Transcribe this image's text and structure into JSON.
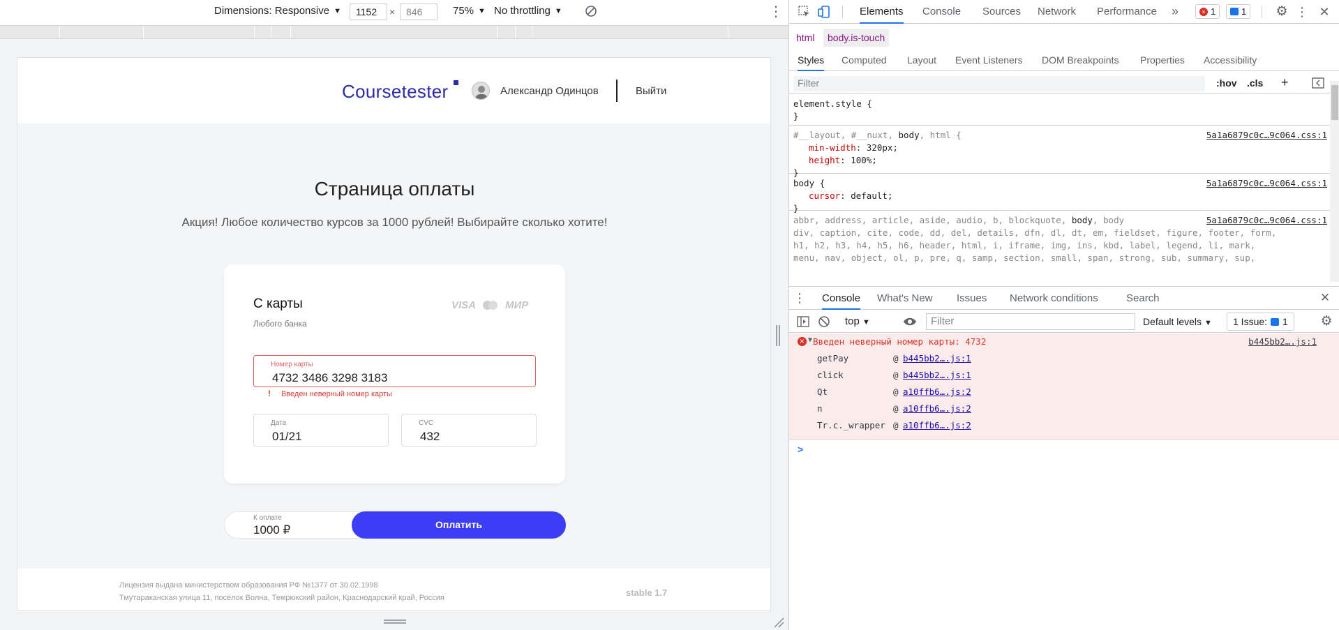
{
  "device_toolbar": {
    "dimensions_label": "Dimensions: Responsive",
    "width": "1152",
    "height": "846",
    "times": "×",
    "zoom": "75%",
    "throttling": "No throttling"
  },
  "page": {
    "logo": "Coursetester",
    "user_name": "Александр Одинцов",
    "logout": "Выйти",
    "title": "Страница оплаты",
    "promo": "Акция! Любое количество курсов за 1000 рублей! Выбирайте сколько хотите!",
    "card": {
      "title": "С карты",
      "subtitle": "Любого банка",
      "brands": [
        "VISA",
        "МИР"
      ],
      "card_number_label": "Номер карты",
      "card_number_value": "4732 3486 3298 3183",
      "error_mark": "!",
      "error_message": "Введен неверный номер карты",
      "date_label": "Дата",
      "date_value": "01/21",
      "cvc_label": "CVC",
      "cvc_value": "432"
    },
    "pay": {
      "label": "К оплате",
      "amount": "1000 ₽",
      "button": "Оплатить"
    },
    "footer": {
      "license": "Лицензия выдана министерством образования РФ №1377 от 30.02.1998",
      "address": "Тмутараканская улица 11, посёлок Волна, Темрюкский район, Краснодарский край, Россия",
      "version": "stable 1.7"
    }
  },
  "devtools": {
    "tabs": [
      "Elements",
      "Console",
      "Sources",
      "Network",
      "Performance"
    ],
    "more": "»",
    "error_count": "1",
    "message_count": "1",
    "breadcrumbs": [
      "html",
      "body.is-touch"
    ],
    "subtabs": [
      "Styles",
      "Computed",
      "Layout",
      "Event Listeners",
      "DOM Breakpoints",
      "Properties",
      "Accessibility"
    ],
    "filter_placeholder": "Filter",
    "hov": ":hov",
    "cls": ".cls",
    "styles": {
      "element_style": "element.style {",
      "close": "}",
      "rule1_selector_dim": "#__layout, #__nuxt, ",
      "rule1_selector": "body",
      "rule1_selector_dim2": ", html {",
      "rule1_prop1": "min-width",
      "rule1_val1": "320px;",
      "rule1_prop2": "height",
      "rule1_val2": "100%;",
      "rule1_src": "5a1a6879c0c…9c064.css:1",
      "rule2_selector": "body {",
      "rule2_prop1": "cursor",
      "rule2_val1": "default;",
      "rule2_src": "5a1a6879c0c…9c064.css:1",
      "rule3_line1_dim": "abbr, address, article, aside, audio, b, blockquote, ",
      "rule3_line1": "body",
      "rule3_line1_dim2": ", body",
      "rule3_line2": "div, caption, cite, code, dd, del, details, dfn, dl, dt, em, fieldset, figure, footer, form,",
      "rule3_line3": "h1, h2, h3, h4, h5, h6, header, html, i, iframe, img, ins, kbd, label, legend, li, mark,",
      "rule3_line4": "menu, nav, object, ol, p, pre, q, samp, section, small, span, strong, sub, summary, sup,",
      "rule3_src": "5a1a6879c0c…9c064.css:1"
    },
    "drawer_tabs": [
      "Console",
      "What's New",
      "Issues",
      "Network conditions",
      "Search"
    ],
    "console": {
      "context": "top",
      "filter_placeholder": "Filter",
      "levels": "Default levels",
      "issues_label": "1 Issue:",
      "issues_count": "1",
      "error_text": "Введен неверный номер карты: 4732",
      "error_src": "b445bb2….js:1",
      "stack": [
        {
          "fn": "getPay",
          "link": "b445bb2….js:1"
        },
        {
          "fn": "click",
          "link": "b445bb2….js:1"
        },
        {
          "fn": "Qt",
          "link": "a10ffb6….js:2"
        },
        {
          "fn": "n",
          "link": "a10ffb6….js:2"
        },
        {
          "fn": "Tr.c._wrapper",
          "link": "a10ffb6….js:2"
        }
      ],
      "at": "@",
      "prompt": ">"
    }
  }
}
